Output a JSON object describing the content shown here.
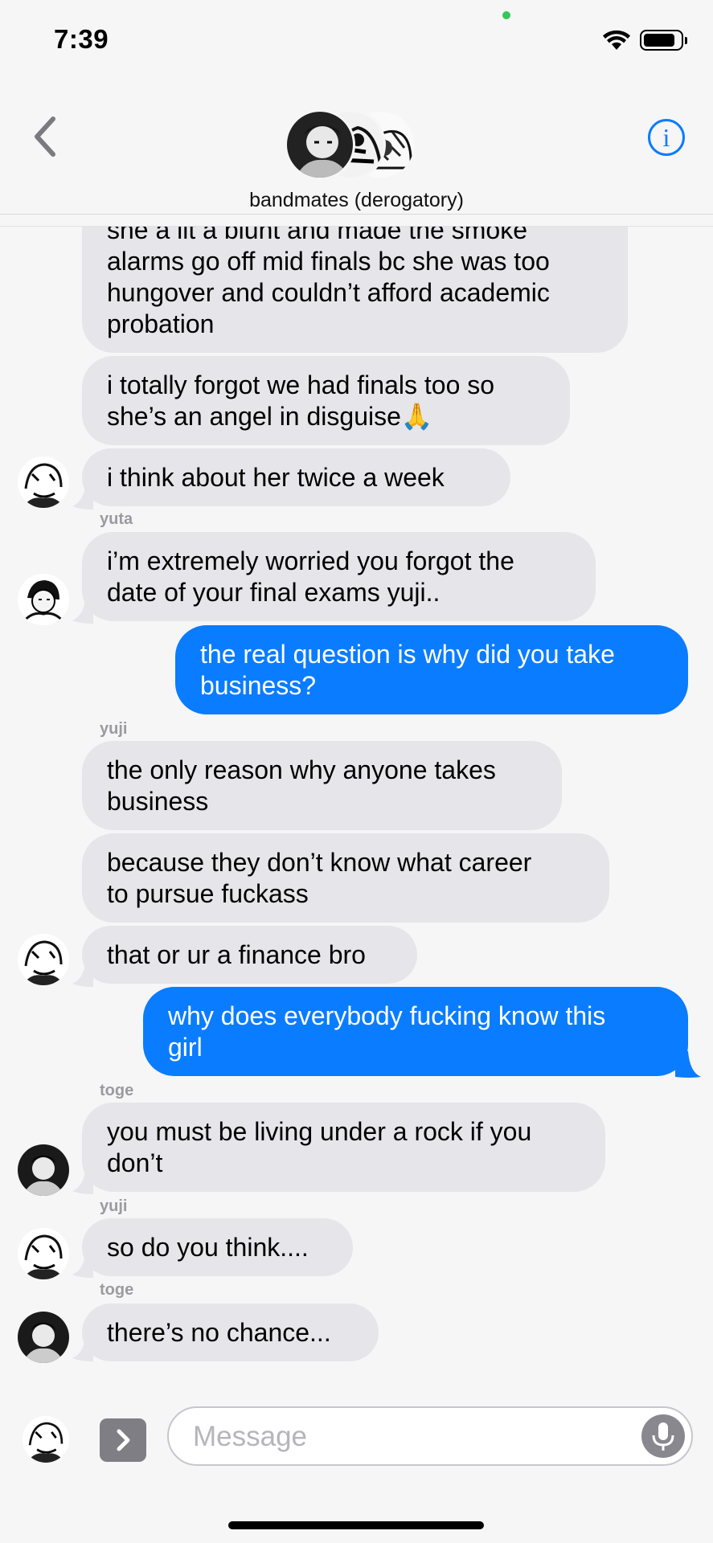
{
  "status_bar": {
    "time": "7:39"
  },
  "header": {
    "title": "bandmates (derogatory)"
  },
  "colors": {
    "sent_bubble": "#0a7cff",
    "received_bubble": "#e5e5ea",
    "accent": "#0a7cff"
  },
  "icons": {
    "back": "chevron-left-icon",
    "info": "info-icon",
    "apps": "chevron-right-icon",
    "mic": "microphone-icon"
  },
  "messages": {
    "m1": {
      "line1": "she a lit a blunt and made the smoke",
      "line2": "alarms go off mid finals bc she was too",
      "line3": "hungover and couldn’t afford academic",
      "line4": "probation"
    },
    "m2": {
      "line1": "i totally forgot we had finals too so",
      "line2": "she’s an angel in disguise🙏"
    },
    "m3": {
      "text": "i think about her twice a week"
    },
    "s1": {
      "name": "yuta"
    },
    "m4": {
      "line1": "i’m extremely worried you forgot the",
      "line2": "date of your final exams yuji.."
    },
    "m5": {
      "line1": "the real question is why did you take",
      "line2": "business?"
    },
    "s2": {
      "name": "yuji"
    },
    "m6": {
      "line1": "the only reason why anyone takes",
      "line2": "business"
    },
    "m7": {
      "line1": "because they don’t know what career",
      "line2": "to pursue fuckass"
    },
    "m8": {
      "text": "that or ur a finance bro"
    },
    "m9": {
      "line1": "why does everybody fucking know this",
      "line2": "girl"
    },
    "s3": {
      "name": "toge"
    },
    "m10": {
      "line1": "you must be living under a rock if you",
      "line2": "don’t"
    },
    "s4": {
      "name": "yuji"
    },
    "m11": {
      "text": "so do you think...."
    },
    "s5": {
      "name": "toge"
    },
    "m12": {
      "text": "there’s no chance..."
    }
  },
  "input": {
    "placeholder": "Message"
  }
}
